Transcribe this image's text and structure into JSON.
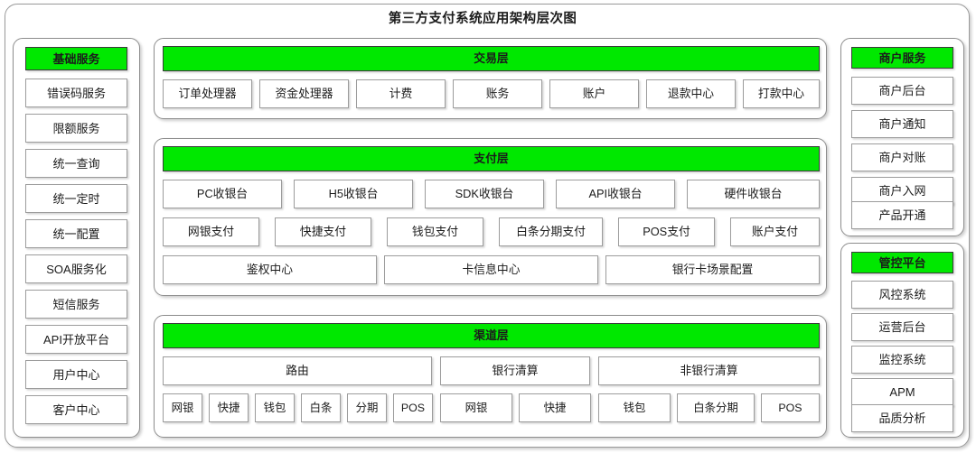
{
  "title": "第三方支付系统应用架构层次图",
  "colors": {
    "header_green": "#00e800",
    "border": "#9c9c9c",
    "panel_border": "#8e8e8e",
    "background": "#ffffff",
    "text": "#1b1b1b"
  },
  "left_column": {
    "header": "基础服务",
    "items": [
      "错误码服务",
      "限额服务",
      "统一查询",
      "统一定时",
      "统一配置",
      "SOA服务化",
      "短信服务",
      "API开放平台",
      "用户中心",
      "客户中心"
    ]
  },
  "right_columns": [
    {
      "header": "商户服务",
      "items": [
        "商户后台",
        "商户通知",
        "商户对账",
        "商户入网",
        "产品开通"
      ]
    },
    {
      "header": "管控平台",
      "items": [
        "风控系统",
        "运营后台",
        "监控系统",
        "APM",
        "品质分析"
      ]
    }
  ],
  "layers": [
    {
      "header": "交易层",
      "rows": [
        {
          "items": [
            "订单处理器",
            "资金处理器",
            "计费",
            "账务",
            "账户",
            "退款中心",
            "打款中心"
          ]
        }
      ]
    },
    {
      "header": "支付层",
      "rows": [
        {
          "items": [
            "PC收银台",
            "H5收银台",
            "SDK收银台",
            "API收银台",
            "硬件收银台"
          ]
        },
        {
          "items": [
            "网银支付",
            "快捷支付",
            "钱包支付",
            "白条分期支付",
            "POS支付",
            "账户支付"
          ]
        },
        {
          "items": [
            "鉴权中心",
            "卡信息中心",
            "银行卡场景配置"
          ]
        }
      ]
    },
    {
      "header": "渠道层",
      "rows": [
        {
          "items": [
            "路由",
            "银行清算",
            "非银行清算"
          ]
        },
        {
          "items": [
            "网银",
            "快捷",
            "钱包",
            "白条",
            "分期",
            "POS",
            "网银",
            "快捷",
            "钱包",
            "白条分期",
            "POS"
          ]
        }
      ]
    }
  ]
}
